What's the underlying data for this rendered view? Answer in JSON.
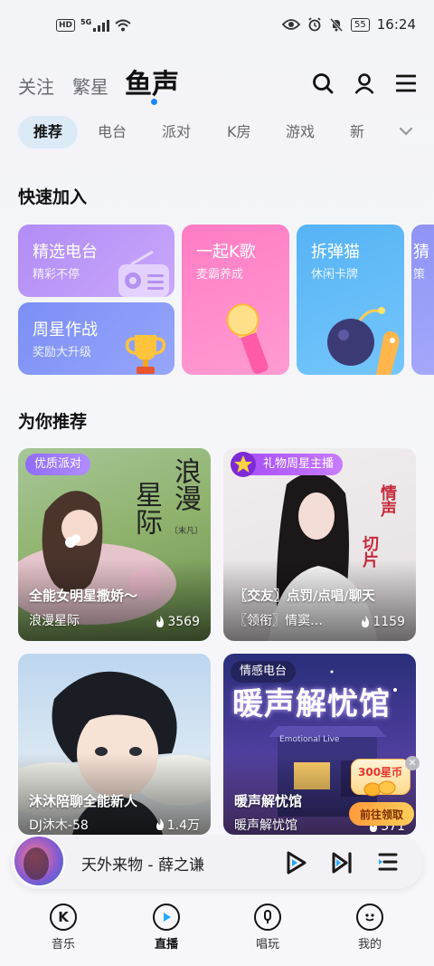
{
  "status_bar": {
    "hd": "HD",
    "network": "5G",
    "battery": "55",
    "time": "16:24"
  },
  "header": {
    "tabs": [
      "关注",
      "繁星",
      "鱼声"
    ],
    "active_tab": "鱼声"
  },
  "categories": [
    "推荐",
    "电台",
    "派对",
    "K房",
    "游戏",
    "新"
  ],
  "quick_join": {
    "title": "快速加入",
    "cards": [
      {
        "title": "精选电台",
        "subtitle": "精彩不停"
      },
      {
        "title": "周星作战",
        "subtitle": "奖励大升级"
      },
      {
        "title": "一起K歌",
        "subtitle": "麦霸养成"
      },
      {
        "title": "拆弹猫",
        "subtitle": "休闲卡牌"
      },
      {
        "title": "猜",
        "subtitle": "策"
      }
    ]
  },
  "recommend": {
    "title": "为你推荐",
    "cards": [
      {
        "badge": "优质派对",
        "art_text_1": "浪漫",
        "art_text_2": "星际",
        "art_small": "〔末凡〕",
        "title": "全能女明星撒娇～",
        "subtitle": "浪漫星际",
        "heat": "3569"
      },
      {
        "badge": "礼物周星主播",
        "art_text_1": "情声",
        "art_text_2": "切片",
        "title": "〖交友〗点罚/点唱/聊天",
        "subtitle": "〖领衔〗情窦…",
        "heat": "1159"
      },
      {
        "badge": "",
        "title": "沐沐陪聊全能新人",
        "subtitle": "DJ沐木-58",
        "heat": "1.4万"
      },
      {
        "badge": "情感电台",
        "art_text_1": "暖声解忧馆",
        "art_small": "Emotional Live",
        "title": "暖声解忧馆",
        "subtitle": "暖声解忧馆",
        "heat": "371"
      }
    ]
  },
  "promo": {
    "coins": "300星币",
    "action": "前往领取"
  },
  "player": {
    "song": "天外来物 - 薛之谦"
  },
  "nav": [
    {
      "label": "音乐"
    },
    {
      "label": "直播"
    },
    {
      "label": "唱玩"
    },
    {
      "label": "我的"
    }
  ]
}
